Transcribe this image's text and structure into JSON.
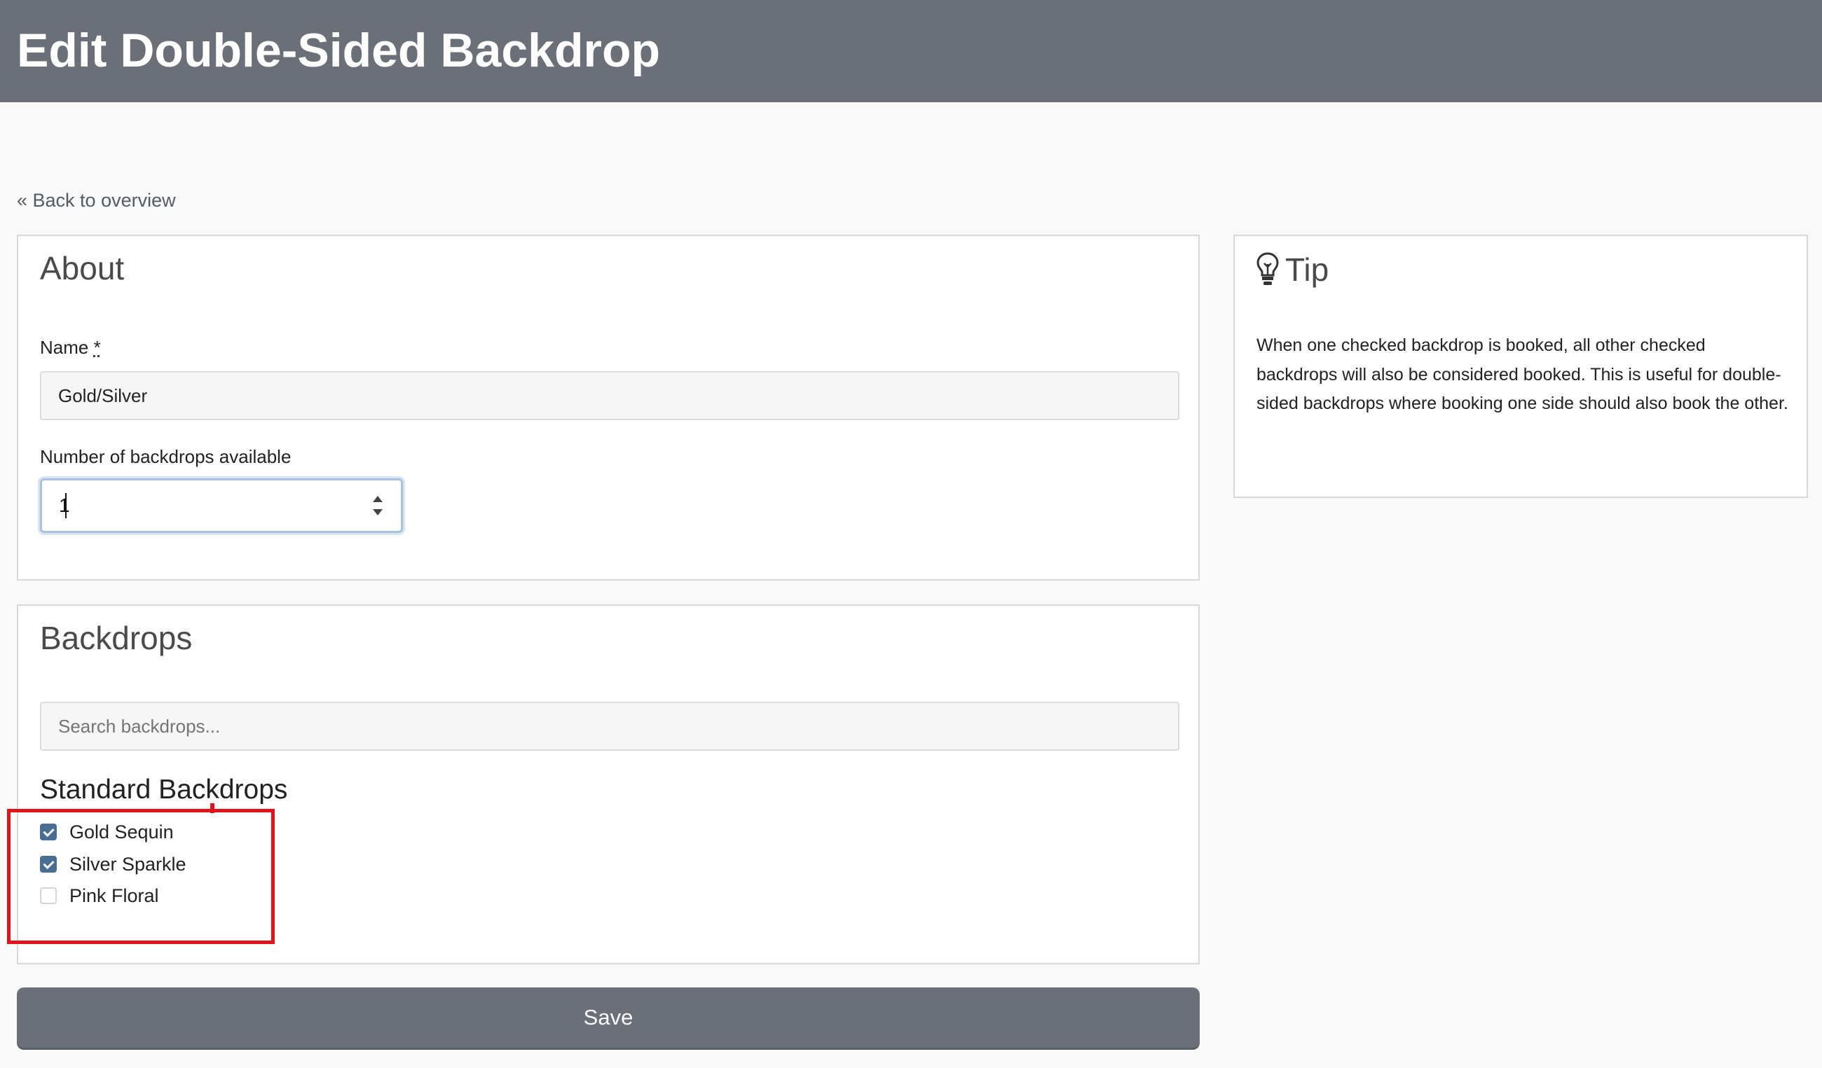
{
  "header": {
    "title": "Edit Double-Sided Backdrop"
  },
  "nav": {
    "back_link": "« Back to overview"
  },
  "about": {
    "title": "About",
    "name_label": "Name",
    "name_required": "*",
    "name_value": "Gold/Silver",
    "count_label": "Number of backdrops available",
    "count_value": "1"
  },
  "backdrops": {
    "title": "Backdrops",
    "search_placeholder": "Search backdrops...",
    "group_title": "Standard Backdrops",
    "items": [
      {
        "label": "Gold Sequin",
        "checked": true
      },
      {
        "label": "Silver Sparkle",
        "checked": true
      },
      {
        "label": "Pink Floral",
        "checked": false
      }
    ]
  },
  "tip": {
    "icon": "lightbulb-icon",
    "title": "Tip",
    "text": "When one checked backdrop is booked, all other checked backdrops will also be considered booked. This is useful for double-sided backdrops where booking one side should also book the other."
  },
  "actions": {
    "save_label": "Save"
  },
  "colors": {
    "header_bg": "#6b7078",
    "checkbox_checked": "#4a6d94",
    "highlight": "#e0151b"
  }
}
